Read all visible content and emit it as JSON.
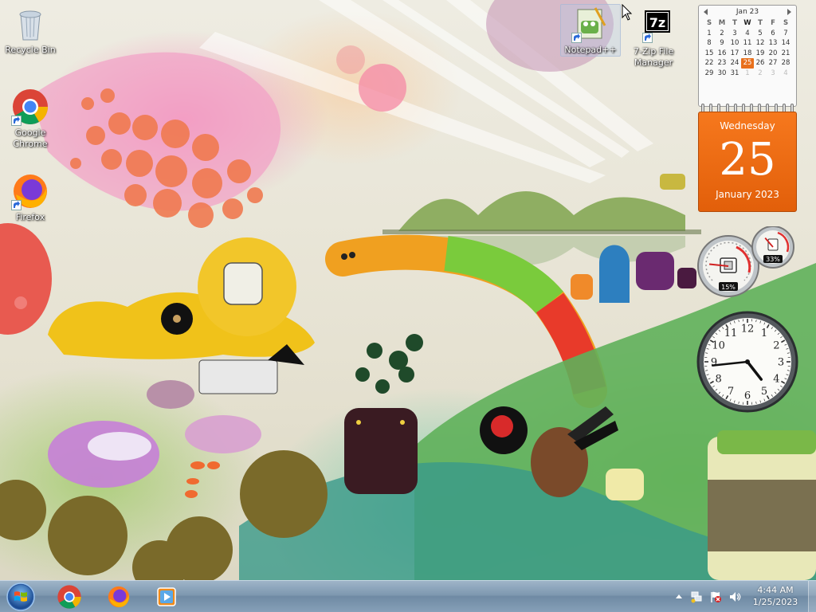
{
  "desktop": {
    "icons": [
      {
        "label": "Recycle Bin",
        "icon": "recycle-bin-icon"
      },
      {
        "label": "Google Chrome",
        "label_line1": "Google",
        "label_line2": "Chrome",
        "icon": "chrome-icon"
      },
      {
        "label": "Firefox",
        "icon": "firefox-icon"
      },
      {
        "label": "Notepad++",
        "icon": "notepad-plus-plus-icon"
      },
      {
        "label": "7-Zip File Manager",
        "label_line1": "7-Zip File",
        "label_line2": "Manager",
        "icon": "7zip-icon"
      }
    ]
  },
  "calendar_gadget": {
    "month_label": "Jan 23",
    "weekday_headers": [
      "S",
      "M",
      "T",
      "W",
      "T",
      "F",
      "S"
    ],
    "weeks": [
      [
        "1",
        "2",
        "3",
        "4",
        "5",
        "6",
        "7"
      ],
      [
        "8",
        "9",
        "10",
        "11",
        "12",
        "13",
        "14"
      ],
      [
        "15",
        "16",
        "17",
        "18",
        "19",
        "20",
        "21"
      ],
      [
        "22",
        "23",
        "24",
        "25",
        "26",
        "27",
        "28"
      ],
      [
        "29",
        "30",
        "31",
        "1",
        "2",
        "3",
        "4"
      ]
    ],
    "today": "25",
    "weekday": "Wednesday",
    "day_number": "25",
    "month_year": "January 2023"
  },
  "cpu_gadget": {
    "cpu_percent": "15%",
    "memory_percent": "33%",
    "cpu_value": 15,
    "memory_value": 33
  },
  "clock_gadget": {
    "numerals": [
      "12",
      "1",
      "2",
      "3",
      "4",
      "5",
      "6",
      "7",
      "8",
      "9",
      "10",
      "11"
    ],
    "hour": 4,
    "minute": 44
  },
  "taskbar": {
    "pinned": [
      {
        "name": "Google Chrome",
        "icon": "chrome-icon"
      },
      {
        "name": "Firefox",
        "icon": "firefox-icon"
      },
      {
        "name": "Windows Media Player",
        "icon": "media-player-icon"
      }
    ],
    "tray": {
      "time": "4:44 AM",
      "date": "1/25/2023",
      "icons": [
        "show-hidden-icons-arrow",
        "action-center-flag-icon",
        "network-icon",
        "volume-icon"
      ]
    }
  },
  "colors": {
    "calendar_accent": "#e8701c",
    "taskbar": "#7e98b0"
  }
}
